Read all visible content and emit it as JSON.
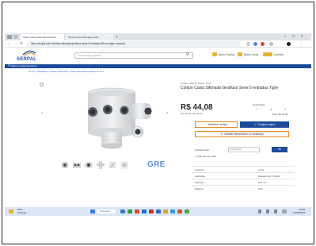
{
  "browser": {
    "tabs": [
      {
        "label": "Sobre Caixa Sifonada Giratória"
      },
      {
        "label": "Serpal Caixa Sifonada Girafl..."
      }
    ],
    "new_tab": "+",
    "window_controls": [
      "–",
      "□",
      "×"
    ],
    "nav": [
      "←",
      "→",
      "↻"
    ],
    "url": "https://serpal.com.br/caixa-sifonada-girafluxo-serie-5-entradas-50-mm-tigre-conjunto"
  },
  "site": {
    "logo": "SERPAL",
    "search_placeholder": "O que você procura?",
    "header_links": [
      "Meus Pedidos",
      "Minha Conta",
      "Carrinho"
    ],
    "nav_label": "☰ Todos os departamentos",
    "breadcrumb": "Home / Hidráulica / Caixas Sifonadas / Caixa Sifonada Girafluxo Serie 5"
  },
  "product": {
    "sku": "Código: 36970 | Marca: Tigre",
    "title": "Conjun Caixa Sifonada Girafluxo Serie 5 entradas Tigre",
    "price": "R$ 44,08",
    "price_unit": "/un.",
    "installments": "Em até 3x sem juros",
    "quantity_label": "Quantidade",
    "quantity": "1",
    "qty_minus": "−",
    "qty_plus": "+",
    "total": "Total: R$ 44,08",
    "gallery_brand": "GRE",
    "buttons": {
      "add_list": "♡ Adicionar na lista",
      "buy": "🛒 Comprar Agora",
      "whatsapp": "☏ Solicitar atendimento no WhatsApp"
    },
    "shipping": {
      "label": "Calcular frete:",
      "placeholder": "00000-000",
      "ok": "OK",
      "help": "☐ Não sei meu CEP"
    },
    "specs": [
      {
        "k": "Garantia",
        "v": "Linha"
      },
      {
        "k": "Aplicação",
        "v": "Residencial / Predial"
      },
      {
        "k": "Diâmetro",
        "v": "100 mm"
      },
      {
        "k": "Material",
        "v": "PVC"
      }
    ]
  },
  "taskbar": {
    "weather_temp": "24°C",
    "weather_desc": "Nublado",
    "search_label": "Pesquisar",
    "time": "10:46",
    "date": "13/09/2023"
  },
  "colors": {
    "brand_blue": "#1d4b9a",
    "accent_orange": "#e08a1e",
    "link_blue": "#2f6cc0"
  }
}
